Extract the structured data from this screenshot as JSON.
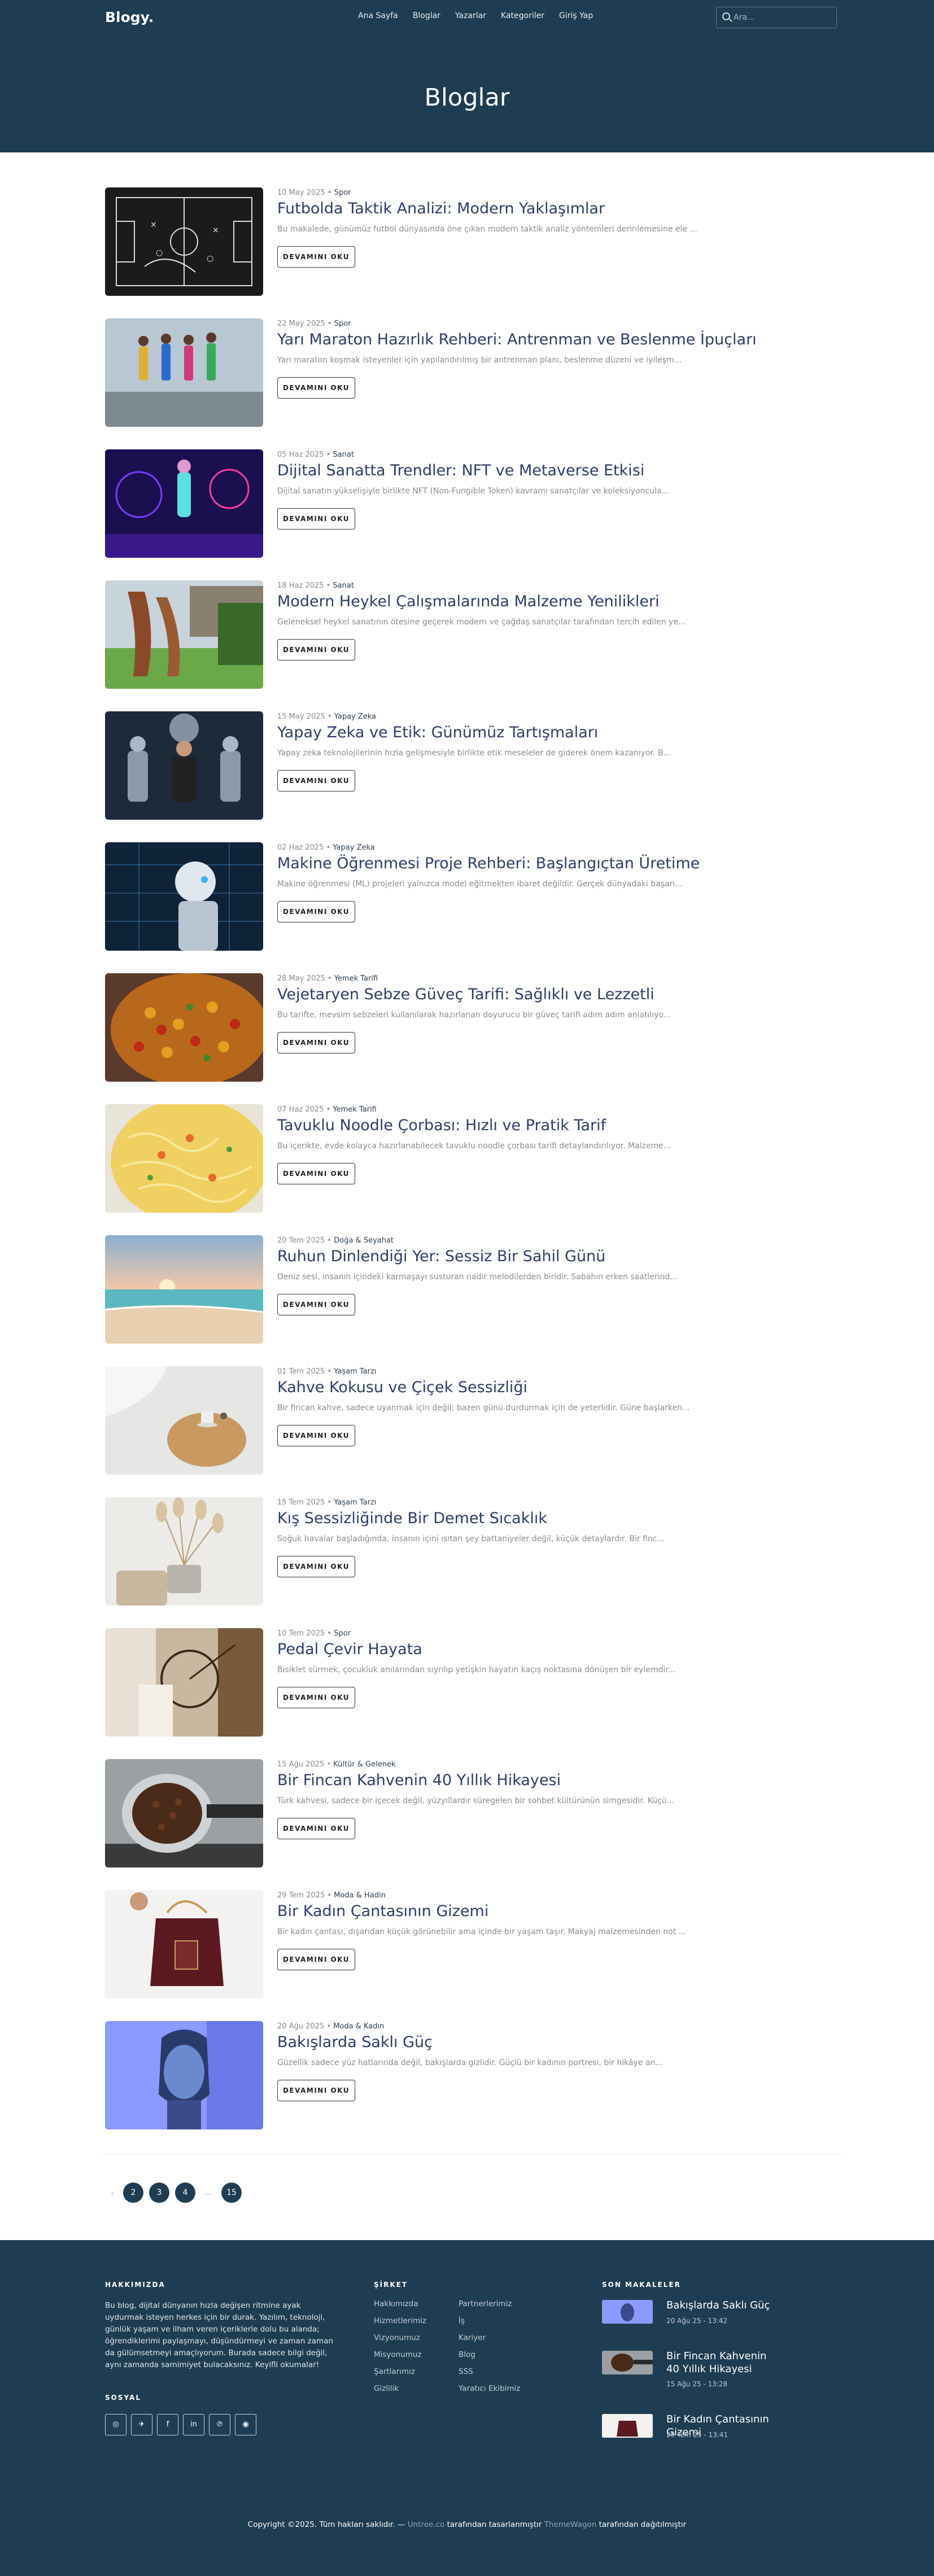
{
  "site": {
    "logo": "Blogy."
  },
  "nav": {
    "items": [
      "Ana Sayfa",
      "Bloglar",
      "Yazarlar",
      "Kategoriler",
      "Giriş Yap"
    ],
    "search_placeholder": "Ara..."
  },
  "hero": {
    "title": "Bloglar"
  },
  "read_more_label": "DEVAMINI OKU",
  "posts": [
    {
      "date": "10 May 2025 •",
      "category": "Spor",
      "title": "Futbolda Taktik Analizi: Modern Yaklaşımlar",
      "excerpt": "Bu makalede, günümüz futbol dünyasında öne çıkan modern taktik analiz yöntemleri derinlemesine ele ..."
    },
    {
      "date": "22 May 2025 •",
      "category": "Spor",
      "title": "Yarı Maraton Hazırlık Rehberi: Antrenman ve Beslenme İpuçları",
      "excerpt": "Yarı maraton koşmak isteyenler için yapılandırılmış bir antrenman planı, beslenme düzeni ve iyileşm..."
    },
    {
      "date": "05 Haz 2025 •",
      "category": "Sanat",
      "title": "Dijital Sanatta Trendler: NFT ve Metaverse Etkisi",
      "excerpt": "Dijital sanatın yükselişiyle birlikte NFT (Non-Fungible Token) kavramı sanatçılar ve koleksiyoncula..."
    },
    {
      "date": "18 Haz 2025 •",
      "category": "Sanat",
      "title": "Modern Heykel Çalışmalarında Malzeme Yenilikleri",
      "excerpt": "Geleneksel heykel sanatının ötesine geçerek modern ve çağdaş sanatçılar tarafından tercih edilen ye..."
    },
    {
      "date": "15 May 2025 •",
      "category": "Yapay Zeka",
      "title": "Yapay Zeka ve Etik: Günümüz Tartışmaları",
      "excerpt": "Yapay zeka teknolojilerinin hızla gelişmesiyle birlikte etik meseleler de giderek önem kazanıyor. B..."
    },
    {
      "date": "02 Haz 2025 •",
      "category": "Yapay Zeka",
      "title": "Makine Öğrenmesi Proje Rehberi: Başlangıçtan Üretime",
      "excerpt": "Makine öğrenmesi (ML) projeleri yalnızca model eğitmekten ibaret değildir. Gerçek dünyadaki başarı..."
    },
    {
      "date": "28 May 2025 •",
      "category": "Yemek Tarifi",
      "title": "Vejetaryen Sebze Güveç Tarifi: Sağlıklı ve Lezzetli",
      "excerpt": "Bu tarifte, mevsim sebzeleri kullanılarak hazırlanan doyurucu bir güveç tarifi adım adım anlatılıyo..."
    },
    {
      "date": "07 Haz 2025 •",
      "category": "Yemek Tarifi",
      "title": "Tavuklu Noodle Çorbası: Hızlı ve Pratik Tarif",
      "excerpt": "Bu içerikte, evde kolayca hazırlanabilecek tavuklu noodle çorbası tarifi detaylandırılıyor. Malzeme..."
    },
    {
      "date": "20 Tem 2025 •",
      "category": "Doğa & Seyahat",
      "title": "Ruhun Dinlendiği Yer: Sessiz Bir Sahil Günü",
      "excerpt": "Deniz sesi, insanın içindeki karmaşayı susturan nadir melodilerden biridir. Sabahın erken saatlerind..."
    },
    {
      "date": "01 Tem 2025 •",
      "category": "Yaşam Tarzı",
      "title": "Kahve Kokusu ve Çiçek Sessizliği",
      "excerpt": "Bir fincan kahve, sadece uyanmak için değil; bazen günü durdurmak için de yeterlidir. Güne başlarken..."
    },
    {
      "date": "15 Tem 2025 •",
      "category": "Yaşam Tarzı",
      "title": "Kış Sessizliğinde Bir Demet Sıcaklık",
      "excerpt": "Soğuk havalar başladığında, insanın içini ısıtan şey battaniyeler değil, küçük detaylardır. Bir finc..."
    },
    {
      "date": "10 Tem 2025 •",
      "category": "Spor",
      "title": "Pedal Çevir Hayata",
      "excerpt": "Bisiklet sürmek, çocukluk anılarından sıyrılıp yetişkin hayatın kaçış noktasına dönüşen bir eylemdir..."
    },
    {
      "date": "15 Ağu 2025 •",
      "category": "Kültür & Gelenek",
      "title": "Bir Fincan Kahvenin 40 Yıllık Hikayesi",
      "excerpt": "Türk kahvesi, sadece bir içecek değil, yüzyıllardır süregelen bir sohbet kültürünün simgesidir. Küçü..."
    },
    {
      "date": "29 Tem 2025 •",
      "category": "Moda & Hadin",
      "title": "Bir Kadın Çantasının Gizemi",
      "excerpt": "Bir kadın çantası, dışarıdan küçük görünebilir ama içinde bir yaşam taşır. Makyaj malzemesinden not ..."
    },
    {
      "date": "20 Ağu 2025 •",
      "category": "Moda & Kadın",
      "title": "Bakışlarda Saklı Güç",
      "excerpt": "Güzellik sadece yüz hatlarında değil, bakışlarda gizlidir. Güçlü bir kadının portresi, bir hikâye an..."
    }
  ],
  "pagination": {
    "prev": "‹",
    "pages": [
      "2",
      "3",
      "4"
    ],
    "ellipsis": "...",
    "last": "15"
  },
  "footer": {
    "about_heading": "HAKKIMIZDA",
    "about_text": "Bu blog, dijital dünyanın hızla değişen ritmine ayak uydurmak isteyen herkes için bir durak. Yazılım, teknoloji, günlük yaşam ve ilham veren içeriklerle dolu bu alanda; öğrendiklerimi paylaşmayı, düşündürmeyi ve zaman zaman da gülümsetmeyi amaçlıyorum. Burada sadece bilgi değil, aynı zamanda samimiyet bulacaksınız. Keyifli okumalar!",
    "social_heading": "SOSYAL",
    "social_icons": [
      "◎",
      "✈",
      "f",
      "in",
      "℗",
      "◉"
    ],
    "company_heading": "ŞİRKET",
    "company_col1": [
      "Hakkımızda",
      "Hizmetlerimiz",
      "Vizyonumuz",
      "Misyonumuz",
      "Şartlarımız",
      "Gizlilik"
    ],
    "company_col2": [
      "Partnerlerimiz",
      "İş",
      "Kariyer",
      "Blog",
      "SSS",
      "Yaratıcı Ekibimiz"
    ],
    "recent_heading": "SON MAKALELER",
    "recent": [
      {
        "title": "Bakışlarda Saklı Güç",
        "date": "20 Ağu 25 - 13:42"
      },
      {
        "title": "Bir Fincan Kahvenin 40 Yıllık Hikayesi",
        "date": "15 Ağu 25 - 13:28"
      },
      {
        "title": "Bir Kadın Çantasının Gizemi",
        "date": "29 Tem 25 - 13:41"
      }
    ],
    "copyright": {
      "pre": "Copyright ©2025. Tüm hakları saklıdır. — ",
      "link1": "Untree.co",
      "mid": " tarafından tasarlanmıştır ",
      "link2": "ThemeWagon",
      "post": " tarafından dağıtılmıştır"
    }
  }
}
